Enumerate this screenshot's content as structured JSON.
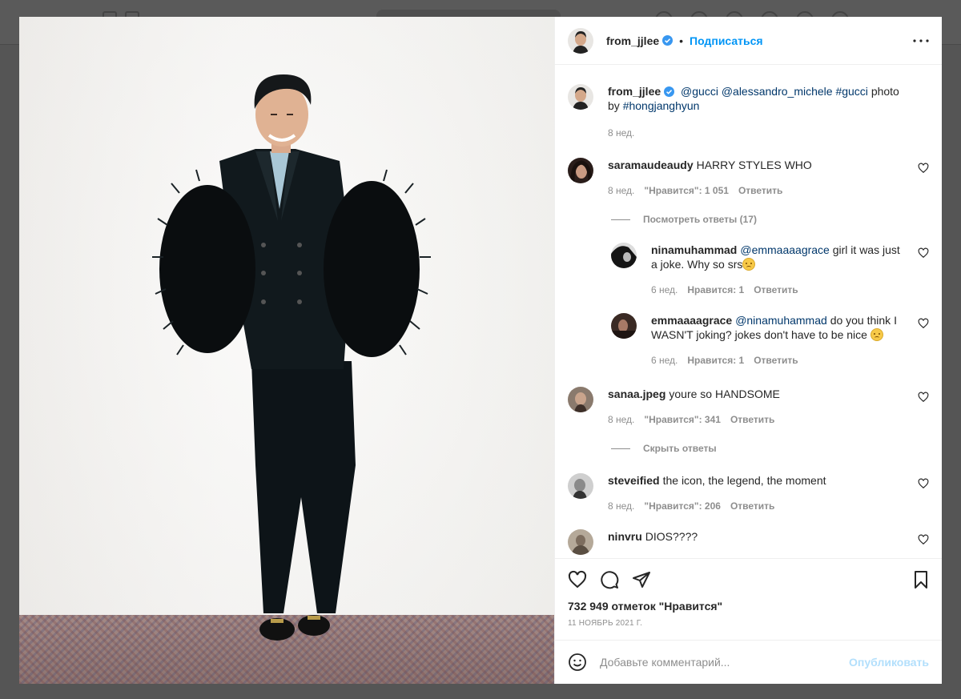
{
  "post": {
    "username": "from_jjlee",
    "follow_label": "Подписаться",
    "dot": "•",
    "caption_username": "from_jjlee",
    "caption": {
      "tag1": "@gucci",
      "tag2": "@alessandro_michele",
      "tag3": "#gucci",
      "text": "photo by",
      "tag4": "#hongjanghyun"
    },
    "caption_time": "8 нед."
  },
  "comments": [
    {
      "user": "saramaudeaudy",
      "text": "HARRY STYLES WHO",
      "time": "8 нед.",
      "likes": "\"Нравится\": 1 051",
      "reply": "Ответить"
    },
    {
      "user": "sanaa.jpeg",
      "text": "youre so HANDSOME",
      "time": "8 нед.",
      "likes": "\"Нравится\": 341",
      "reply": "Ответить"
    },
    {
      "user": "steveified",
      "text": "the icon, the legend, the moment",
      "time": "8 нед.",
      "likes": "\"Нравится\": 206",
      "reply": "Ответить"
    },
    {
      "user": "ninvru",
      "text": "DIOS????"
    }
  ],
  "replies_toggle_1": "Посмотреть ответы (17)",
  "replies_toggle_2": "Скрыть ответы",
  "replies": [
    {
      "user": "ninamuhammad",
      "mention": "@emmaaaagrace",
      "text": "girl it was just a joke. Why so srs",
      "time": "6 нед.",
      "likes": "Нравится: 1",
      "reply": "Ответить"
    },
    {
      "user": "emmaaaagrace",
      "mention": "@ninamuhammad",
      "text": "do you think I WASN'T joking? jokes don't have to be nice",
      "time": "6 нед.",
      "likes": "Нравится: 1",
      "reply": "Ответить"
    }
  ],
  "likes_count": "732 949 отметок \"Нравится\"",
  "date": "11 НОЯБРЬ 2021 Г.",
  "comment_box": {
    "placeholder": "Добавьте комментарий...",
    "publish": "Опубликовать"
  },
  "colors": {
    "accent": "#0095f6",
    "publish_disabled": "#b2dffc",
    "text": "#262626",
    "muted": "#8e8e8e",
    "overlay": "#555555"
  }
}
